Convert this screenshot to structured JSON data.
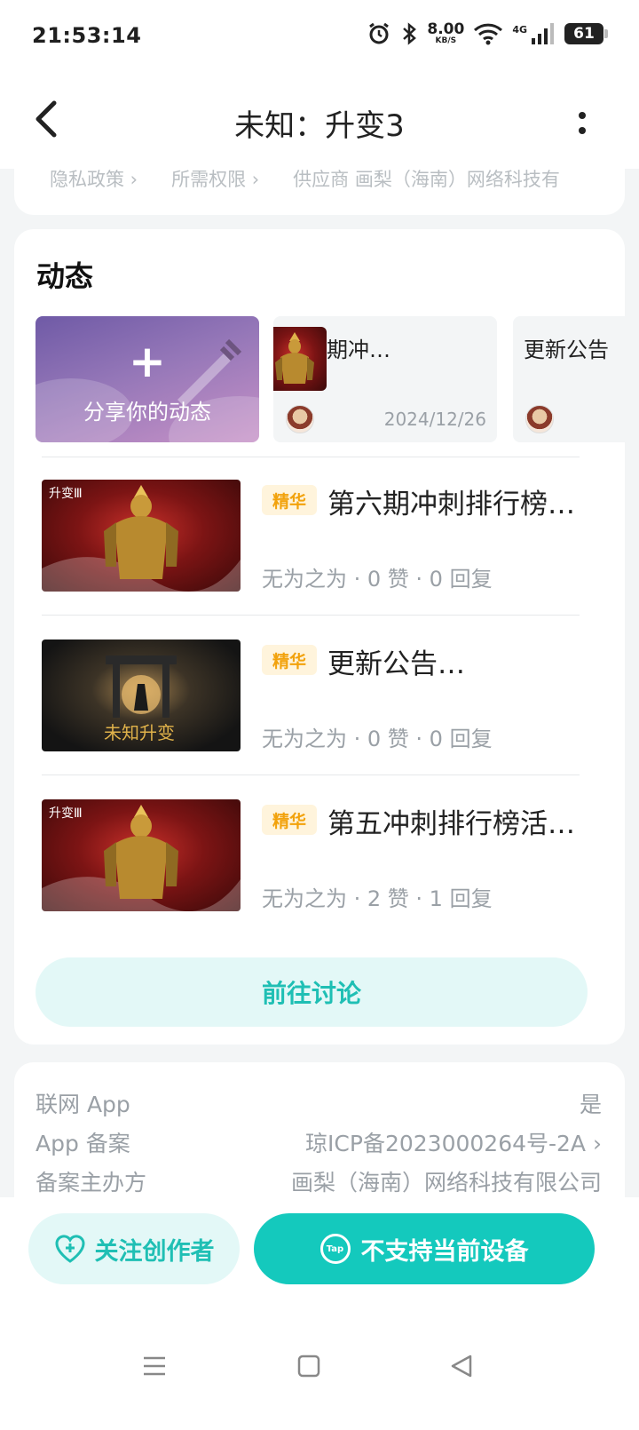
{
  "status_bar": {
    "time": "21:53:14",
    "net_speed": "8.00",
    "net_speed_unit": "KB/S",
    "network_type": "4G",
    "battery": "61"
  },
  "header": {
    "title": "未知：升变3"
  },
  "policy_links": [
    "隐私政策",
    "所需权限",
    "供应商 画梨（海南）网络科技有"
  ],
  "dynamics": {
    "title": "动态",
    "share_label": "分享你的动态",
    "share_icon": "plus-icon",
    "cards": [
      {
        "title": "第六期冲…",
        "date": "2024/12/26"
      },
      {
        "title": "更新公告"
      }
    ],
    "posts": [
      {
        "tag": "精华",
        "title": "第六期冲刺排行榜…",
        "meta": "无为之为 · 0 赞 · 0 回复"
      },
      {
        "tag": "精华",
        "title": "更新公告…",
        "meta": "无为之为 · 0 赞 · 0 回复"
      },
      {
        "tag": "精华",
        "title": "第五冲刺排行榜活…",
        "meta": "无为之为 · 2 赞 · 1 回复"
      }
    ],
    "goto_label": "前往讨论"
  },
  "info": {
    "rows": [
      {
        "label": "联网 App",
        "value": "是"
      },
      {
        "label": "App 备案",
        "value": "琼ICP备2023000264号-2A"
      },
      {
        "label": "备案主办方",
        "value": "画梨（海南）网络科技有限公司"
      }
    ]
  },
  "bottom": {
    "follow_label": "关注创作者",
    "install_label": "不支持当前设备"
  },
  "colors": {
    "accent": "#14c9bd",
    "accent_light": "#e3f8f7",
    "tag_bg": "#fff4dc",
    "tag_text": "#f2a20c"
  }
}
